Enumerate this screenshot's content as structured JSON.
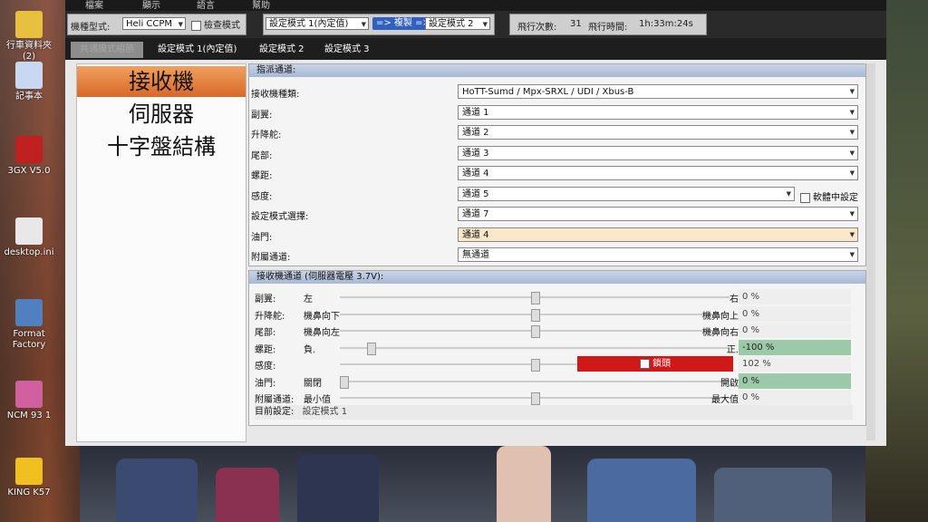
{
  "desktop": {
    "icons": [
      {
        "label": "行車資料夾\n(2)",
        "icon": "folder-icon"
      },
      {
        "label": "記事本",
        "icon": "notepad-icon"
      },
      {
        "label": "3GX V5.0",
        "icon": "app-icon"
      },
      {
        "label": "desktop.ini",
        "icon": "file-icon"
      },
      {
        "label": "Format Factory",
        "icon": "format-factory-icon"
      },
      {
        "label": "NCM 93 1",
        "icon": "ncm-icon"
      },
      {
        "label": "KING K57",
        "icon": "king-icon"
      }
    ]
  },
  "menu": [
    "檔案",
    "顯示",
    "語言",
    "幫助"
  ],
  "toolbar": {
    "model_label": "機種型式:",
    "model_value": "Heli CCPM",
    "check_mode_label": "檢查模式",
    "source_profile": "設定模式 1(內定值)",
    "copy_button": "=> 複製 =>",
    "target_profile": "設定模式 2",
    "flight_count_label": "飛行次數:",
    "flight_count": "31",
    "flight_time_label": "飛行時間:",
    "flight_time": "1h:33m:24s"
  },
  "tabs": [
    "共通模式組態",
    "設定模式 1(內定值)",
    "設定模式 2",
    "設定模式 3"
  ],
  "nav": [
    "接收機",
    "伺服器",
    "十字盤結構"
  ],
  "assign": {
    "title": "指派通道:",
    "rows": [
      {
        "label": "接收機種類:",
        "value": "HoTT-Sumd / Mpx-SRXL / UDI / Xbus-B"
      },
      {
        "label": "副翼:",
        "value": "通道 1"
      },
      {
        "label": "升降舵:",
        "value": "通道 2"
      },
      {
        "label": "尾部:",
        "value": "通道 3"
      },
      {
        "label": "螺距:",
        "value": "通道 4"
      },
      {
        "label": "感度:",
        "value": "通道 5"
      },
      {
        "label": "設定模式選擇:",
        "value": "通道 7"
      },
      {
        "label": "油門:",
        "value": "通道 4"
      },
      {
        "label": "附屬通道:",
        "value": "無通道"
      }
    ],
    "software_setting_label": "軟體中設定"
  },
  "receiver": {
    "title": "接收機通道 (伺服器電壓 3.7V):",
    "rows": [
      {
        "label": "副翼:",
        "low": "左",
        "high": "右",
        "value": "0 %",
        "pos": 0.5
      },
      {
        "label": "升降舵:",
        "low": "機鼻向下",
        "high": "機鼻向上",
        "value": "0 %",
        "pos": 0.5
      },
      {
        "label": "尾部:",
        "low": "機鼻向左",
        "high": "機鼻向右",
        "value": "0 %",
        "pos": 0.5
      },
      {
        "label": "螺距:",
        "low": "負.",
        "high": "正.",
        "value": "-100 %",
        "pos": 0.07
      },
      {
        "label": "感度:",
        "low": "",
        "high": "",
        "value": "102 %",
        "pos": 0.5
      },
      {
        "label": "油門:",
        "low": "關閉",
        "high": "開啟",
        "value": "0 %",
        "pos": 0.0
      },
      {
        "label": "附屬通道:",
        "low": "最小值",
        "high": "最大值",
        "value": "0 %",
        "pos": 0.5
      }
    ],
    "lock_label": "鎖頭",
    "current_setting_label": "目前設定:",
    "current_setting": "設定模式 1"
  },
  "colors": {
    "accent": "#d86828",
    "lock": "#d01818",
    "green": "#9ccaa8"
  }
}
